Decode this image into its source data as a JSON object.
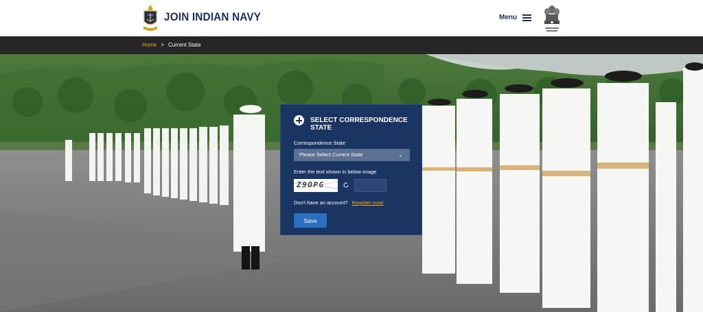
{
  "header": {
    "brand": "JOIN INDIAN NAVY",
    "menu_label": "Menu"
  },
  "breadcrumb": {
    "home": "Home",
    "separator": ">",
    "current": "Current State"
  },
  "form": {
    "title": "SELECT CORRESPONDENCE STATE",
    "state_label": "Correspondence State",
    "state_placeholder": "Please Select Current State",
    "captcha_label": "Enter the text shown in below image",
    "captcha_text": "Z9OPG",
    "captcha_input_value": "",
    "account_prompt": "Don't have an account?",
    "register_link": "Register now!",
    "save_label": "Save"
  },
  "colors": {
    "brand_navy": "#1d2e63",
    "card_bg": "#1a3561",
    "accent_gold": "#f0a81c",
    "button_blue": "#2a6fc0",
    "breadcrumb_bar": "#262626"
  },
  "icons": {
    "logo": "navy-crest-icon",
    "menu": "hamburger-icon",
    "emblem": "national-emblem-icon",
    "add": "plus-circle-icon",
    "refresh": "refresh-icon"
  }
}
